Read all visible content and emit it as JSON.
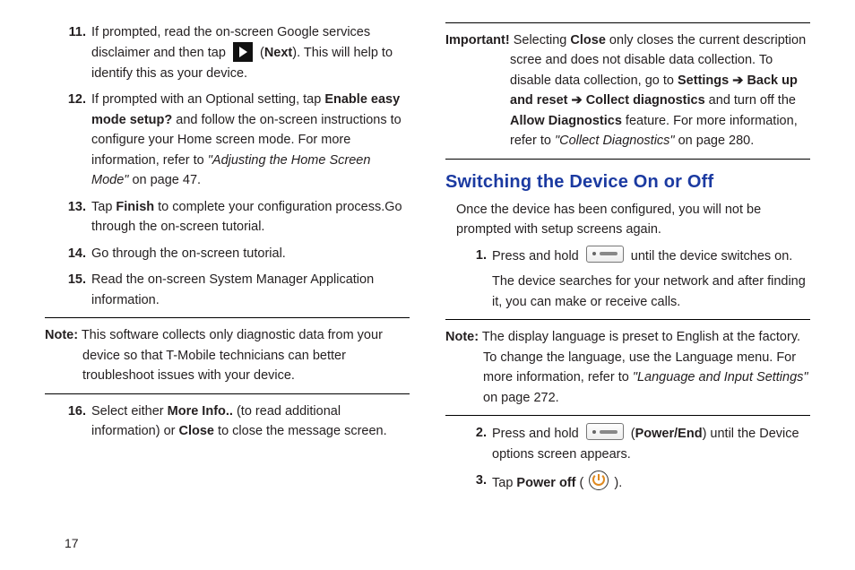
{
  "left": {
    "items": [
      {
        "num": "11.",
        "pre": "If prompted, read the on-screen Google services disclaimer and then tap ",
        "mid_b": "Next",
        "post": "). This will help to identify this as your device."
      },
      {
        "num": "12.",
        "t1": "If prompted with an Optional setting, tap ",
        "b1": "Enable easy mode setup?",
        "t2": " and follow the on-screen instructions to configure your Home screen mode. For more information, refer to ",
        "ref": "\"Adjusting the Home Screen Mode\"",
        "t3": " on page 47."
      },
      {
        "num": "13.",
        "t1": "Tap ",
        "b1": "Finish",
        "t2": " to complete your configuration process.Go through the on-screen tutorial."
      },
      {
        "num": "14.",
        "t": "Go through the on-screen tutorial."
      },
      {
        "num": "15.",
        "t": "Read the on-screen System Manager Application information."
      }
    ],
    "note_label": "Note:",
    "note_body": " This software collects only diagnostic data from your device so that T-Mobile technicians can better troubleshoot issues with your device.",
    "item16": {
      "num": "16.",
      "t1": "Select either ",
      "b1": "More Info..",
      "t2": " (to read additional information) or ",
      "b2": "Close",
      "t3": " to close the message screen."
    }
  },
  "right": {
    "imp_label": "Important!",
    "imp_t1": " Selecting ",
    "imp_b1": "Close",
    "imp_t2": " only closes the current description scree and does not disable data collection. To disable data collection, go to ",
    "imp_b2": "Settings",
    "arrow": " ➔ ",
    "imp_b3": "Back up and reset",
    "imp_b4": "Collect diagnostics",
    "imp_t3": " and turn off the ",
    "imp_b5": "Allow Diagnostics",
    "imp_t4": " feature. For more information, refer to ",
    "imp_ref": "\"Collect Diagnostics\"",
    "imp_t5": "  on page 280.",
    "heading": "Switching the Device On or Off",
    "intro": "Once the device has been configured, you will not be prompted with setup screens again.",
    "s1": {
      "num": "1.",
      "t1": "Press and hold ",
      "t2": " until the device switches on.",
      "t3": "The device searches for your network and after finding it, you can make or receive calls."
    },
    "note2_label": "Note:",
    "note2_body": " The display language is preset to English at the factory. To change the language, use the Language menu. For more information, refer to ",
    "note2_ref": "\"Language and Input Settings\"",
    "note2_tail": "  on page 272.",
    "s2": {
      "num": "2.",
      "t1": "Press and hold ",
      "b1": "Power/End",
      "t2": ") until the Device options screen appears."
    },
    "s3": {
      "num": "3.",
      "t1": "Tap ",
      "b1": "Power off",
      "t2": " ( ",
      "t3": " )."
    }
  },
  "page_number": "17"
}
